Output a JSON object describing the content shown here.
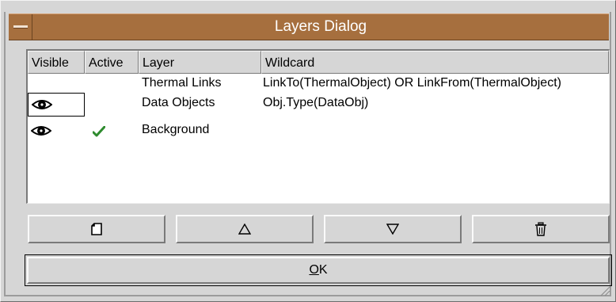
{
  "window": {
    "title": "Layers Dialog"
  },
  "table": {
    "columns": [
      "Visible",
      "Active",
      "Layer",
      "Wildcard"
    ],
    "rows": [
      {
        "visible": false,
        "active": false,
        "layer": "Thermal Links",
        "wildcard": "LinkTo(ThermalObject) OR LinkFrom(ThermalObject)"
      },
      {
        "visible": true,
        "active": false,
        "layer": "Data Objects",
        "wildcard": "Obj.Type(DataObj)"
      },
      {
        "visible": true,
        "active": true,
        "layer": "Background",
        "wildcard": ""
      }
    ],
    "focused_row": 1
  },
  "buttons": {
    "new_icon": "new-layer-icon",
    "up_icon": "move-up-icon",
    "down_icon": "move-down-icon",
    "delete_icon": "trash-icon",
    "ok_mnemonic": "O",
    "ok_rest": "K"
  },
  "colors": {
    "titlebar": "#a66f3e",
    "check": "#2e8b2e"
  }
}
